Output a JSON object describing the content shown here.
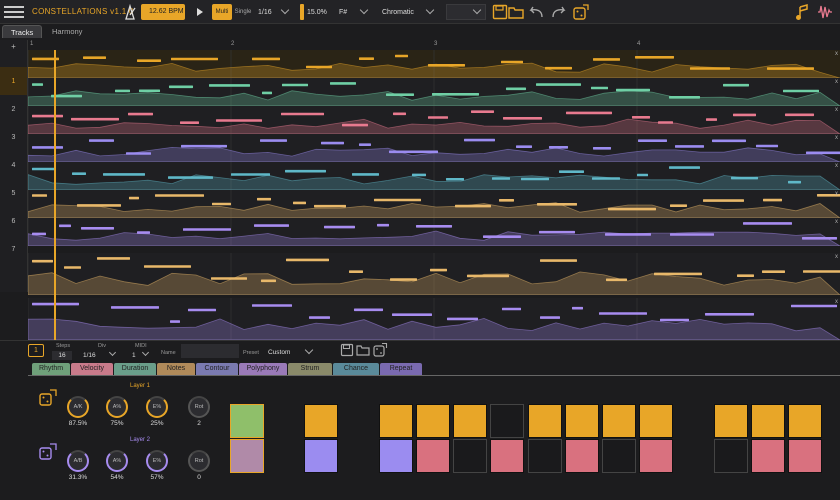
{
  "app": {
    "title": "CONSTELLATIONS v1.1.0"
  },
  "transport": {
    "bpm": "12.62 BPM",
    "mode_multi": "Multi",
    "mode_single": "Single",
    "division": "1/16",
    "swing": "15.0%",
    "key": "F#",
    "scale": "Chromatic",
    "preset_field": ""
  },
  "tabs": [
    {
      "label": "Tracks"
    },
    {
      "label": "Harmony"
    }
  ],
  "ruler": {
    "marks": [
      "1",
      "2",
      "3",
      "4"
    ]
  },
  "tracks": {
    "add_label": "+",
    "items": [
      {
        "num": "1",
        "color": "#e8a628"
      },
      {
        "num": "2",
        "color": "#6fcfa5"
      },
      {
        "num": "3",
        "color": "#e87a8f"
      },
      {
        "num": "4",
        "color": "#9b8cf0"
      },
      {
        "num": "5",
        "color": "#5fb8c8"
      },
      {
        "num": "6",
        "color": "#e8b86a"
      },
      {
        "num": "7",
        "color": "#a78cf0"
      }
    ],
    "close_label": "x"
  },
  "pattern": {
    "index": "1",
    "steps_label": "Steps",
    "steps": "16",
    "div_label": "Div",
    "div": "1/16",
    "midi_label": "MIDI",
    "midi": "1",
    "name_label": "Name",
    "name": "",
    "preset_label": "Preset",
    "preset": "Custom"
  },
  "param_tabs": [
    {
      "label": "Rhythm",
      "color": "#6fa07a"
    },
    {
      "label": "Velocity",
      "color": "#c87a8a"
    },
    {
      "label": "Duration",
      "color": "#6a9e8a"
    },
    {
      "label": "Notes",
      "color": "#b08a5a"
    },
    {
      "label": "Contour",
      "color": "#7a7ab0"
    },
    {
      "label": "Polyphony",
      "color": "#9a7ab8"
    },
    {
      "label": "Strum",
      "color": "#8a8a6a"
    },
    {
      "label": "Chance",
      "color": "#5a8a9a"
    },
    {
      "label": "Repeat",
      "color": "#7a6ab0"
    }
  ],
  "layers": [
    {
      "title": "Layer 1",
      "color": "#e8a628",
      "knobs": [
        {
          "label": "A/K",
          "value": "87.5%"
        },
        {
          "label": "A%",
          "value": "75%"
        },
        {
          "label": "E%",
          "value": "25%"
        },
        {
          "label": "Rot",
          "value": "2"
        }
      ]
    },
    {
      "title": "Layer 2",
      "color": "#a78cf0",
      "knobs": [
        {
          "label": "A/B",
          "value": "31.3%"
        },
        {
          "label": "A%",
          "value": "54%"
        },
        {
          "label": "E%",
          "value": "57%"
        },
        {
          "label": "Rot",
          "value": "0"
        }
      ]
    }
  ],
  "steps_grid": {
    "top": [
      "green",
      "empty",
      "orange",
      "empty",
      "orange",
      "orange",
      "orange",
      "dark",
      "orange",
      "orange",
      "orange",
      "orange",
      "empty",
      "orange",
      "orange",
      "orange"
    ],
    "bottom": [
      "mauve",
      "empty",
      "purple",
      "empty",
      "purple",
      "pink",
      "dark",
      "pink",
      "dark",
      "pink",
      "dark",
      "pink",
      "empty",
      "dark",
      "pink",
      "pink"
    ]
  },
  "colors": {
    "accent": "#e8a628",
    "bg": "#1c1c1e"
  }
}
